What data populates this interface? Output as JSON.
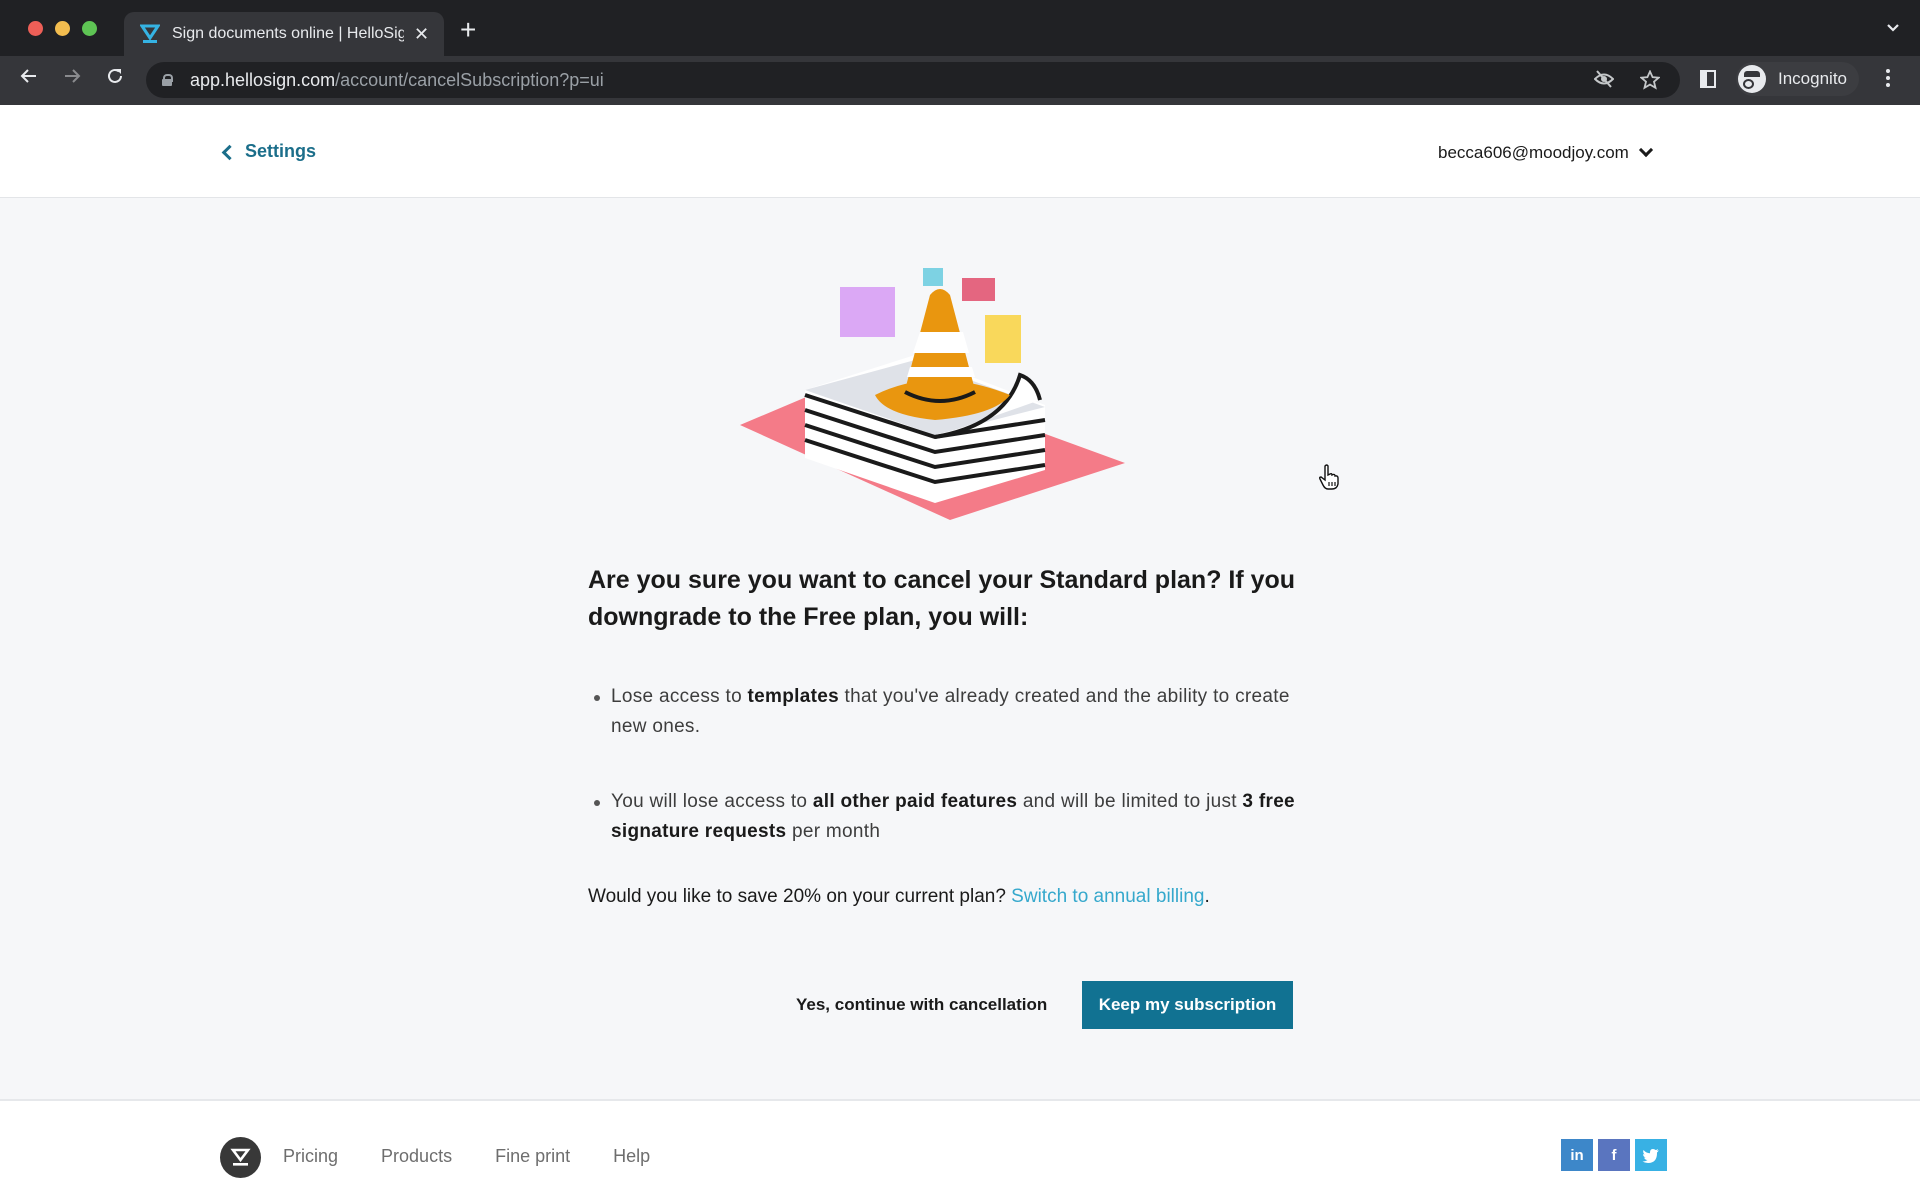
{
  "browser": {
    "tab_title": "Sign documents online | HelloSign",
    "new_tab_label": "+",
    "url_host": "app.hellosign.com",
    "url_path": "/account/cancelSubscription?p=ui",
    "profile_label": "Incognito"
  },
  "header": {
    "back_label": "Settings",
    "account_email": "becca606@moodjoy.com"
  },
  "main": {
    "heading": "Are you sure you want to cancel your Standard plan? If you downgrade to the Free plan, you will:",
    "bullets": [
      {
        "parts": [
          {
            "text": "Lose access to ",
            "bold": false
          },
          {
            "text": "templates",
            "bold": true
          },
          {
            "text": " that you've already created and the ability to create new ones.",
            "bold": false
          }
        ]
      },
      {
        "parts": [
          {
            "text": "You will lose access to ",
            "bold": false
          },
          {
            "text": "all other paid features",
            "bold": true
          },
          {
            "text": " and will be limited to just ",
            "bold": false
          },
          {
            "text": "3 free signature requests",
            "bold": true
          },
          {
            "text": " per month",
            "bold": false
          }
        ]
      }
    ],
    "save_prompt": "Would you like to save 20% on your current plan? ",
    "annual_link": "Switch to annual billing",
    "save_suffix": ".",
    "cancel_button": "Yes, continue with cancellation",
    "keep_button": "Keep my subscription"
  },
  "footer": {
    "links": [
      "Pricing",
      "Products",
      "Fine print",
      "Help"
    ],
    "social": [
      {
        "name": "linkedin",
        "glyph": "in"
      },
      {
        "name": "facebook",
        "glyph": "f"
      },
      {
        "name": "twitter",
        "glyph": "t"
      }
    ]
  },
  "colors": {
    "brand_teal": "#117292",
    "link_blue": "#35a8cc",
    "settings_link": "#1b6e8a"
  }
}
